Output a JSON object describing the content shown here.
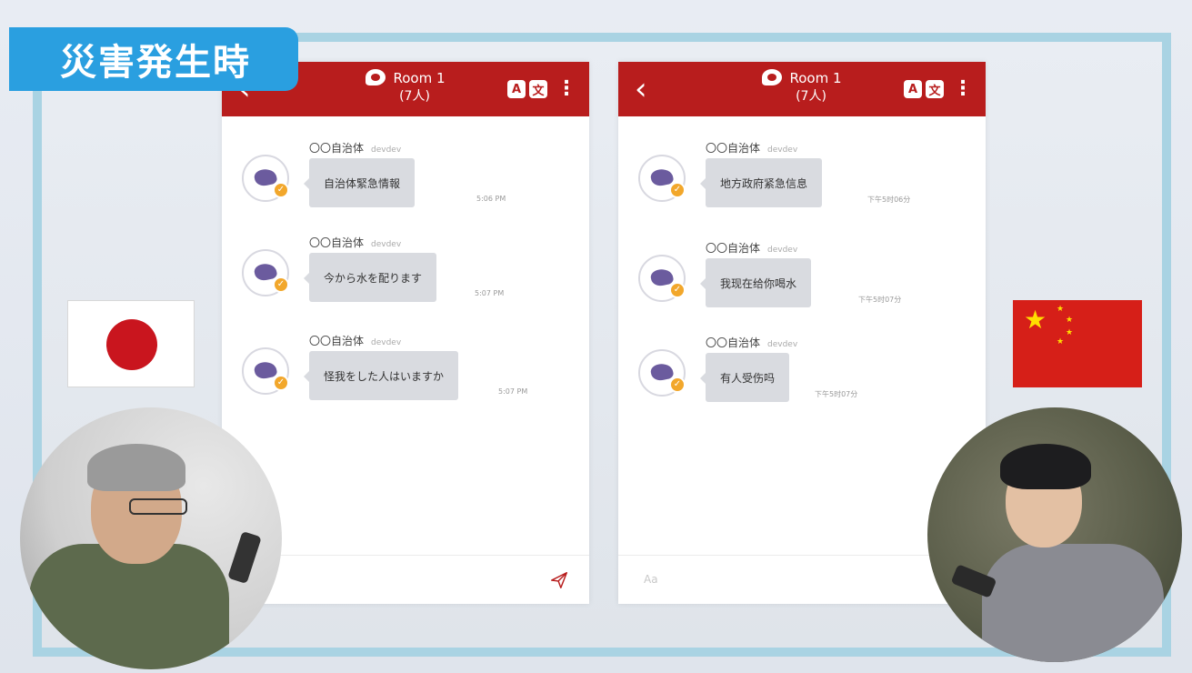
{
  "banner": {
    "title": "災害発生時"
  },
  "left_phone": {
    "room_name": "Room 1",
    "member_count": "(7人)",
    "translate_labels": [
      "A",
      "文"
    ],
    "messages": [
      {
        "sender": "〇〇自治体",
        "sender_id": "devdev",
        "text": "自治体緊急情報",
        "time": "5:06 PM"
      },
      {
        "sender": "〇〇自治体",
        "sender_id": "devdev",
        "text": "今から水を配ります",
        "time": "5:07 PM"
      },
      {
        "sender": "〇〇自治体",
        "sender_id": "devdev",
        "text": "怪我をした人はいますか",
        "time": "5:07 PM"
      }
    ]
  },
  "right_phone": {
    "room_name": "Room 1",
    "member_count": "(7人)",
    "translate_labels": [
      "A",
      "文"
    ],
    "input_placeholder": "Aa",
    "messages": [
      {
        "sender": "〇〇自治体",
        "sender_id": "devdev",
        "text": "地方政府紧急信息",
        "time": "下午5时06分"
      },
      {
        "sender": "〇〇自治体",
        "sender_id": "devdev",
        "text": "我现在给你喝水",
        "time": "下午5时07分"
      },
      {
        "sender": "〇〇自治体",
        "sender_id": "devdev",
        "text": "有人受伤吗",
        "time": "下午5时07分"
      }
    ]
  },
  "colors": {
    "header": "#b81d1d",
    "banner": "#2a9fe0",
    "frame": "#a9d3e3",
    "bubble": "#d9dbe0"
  },
  "icons": {
    "back": "chevron-left-icon",
    "room": "chat-bubble-icon",
    "menu": "kebab-icon",
    "send": "paper-plane-icon",
    "verified": "check-badge-icon"
  }
}
